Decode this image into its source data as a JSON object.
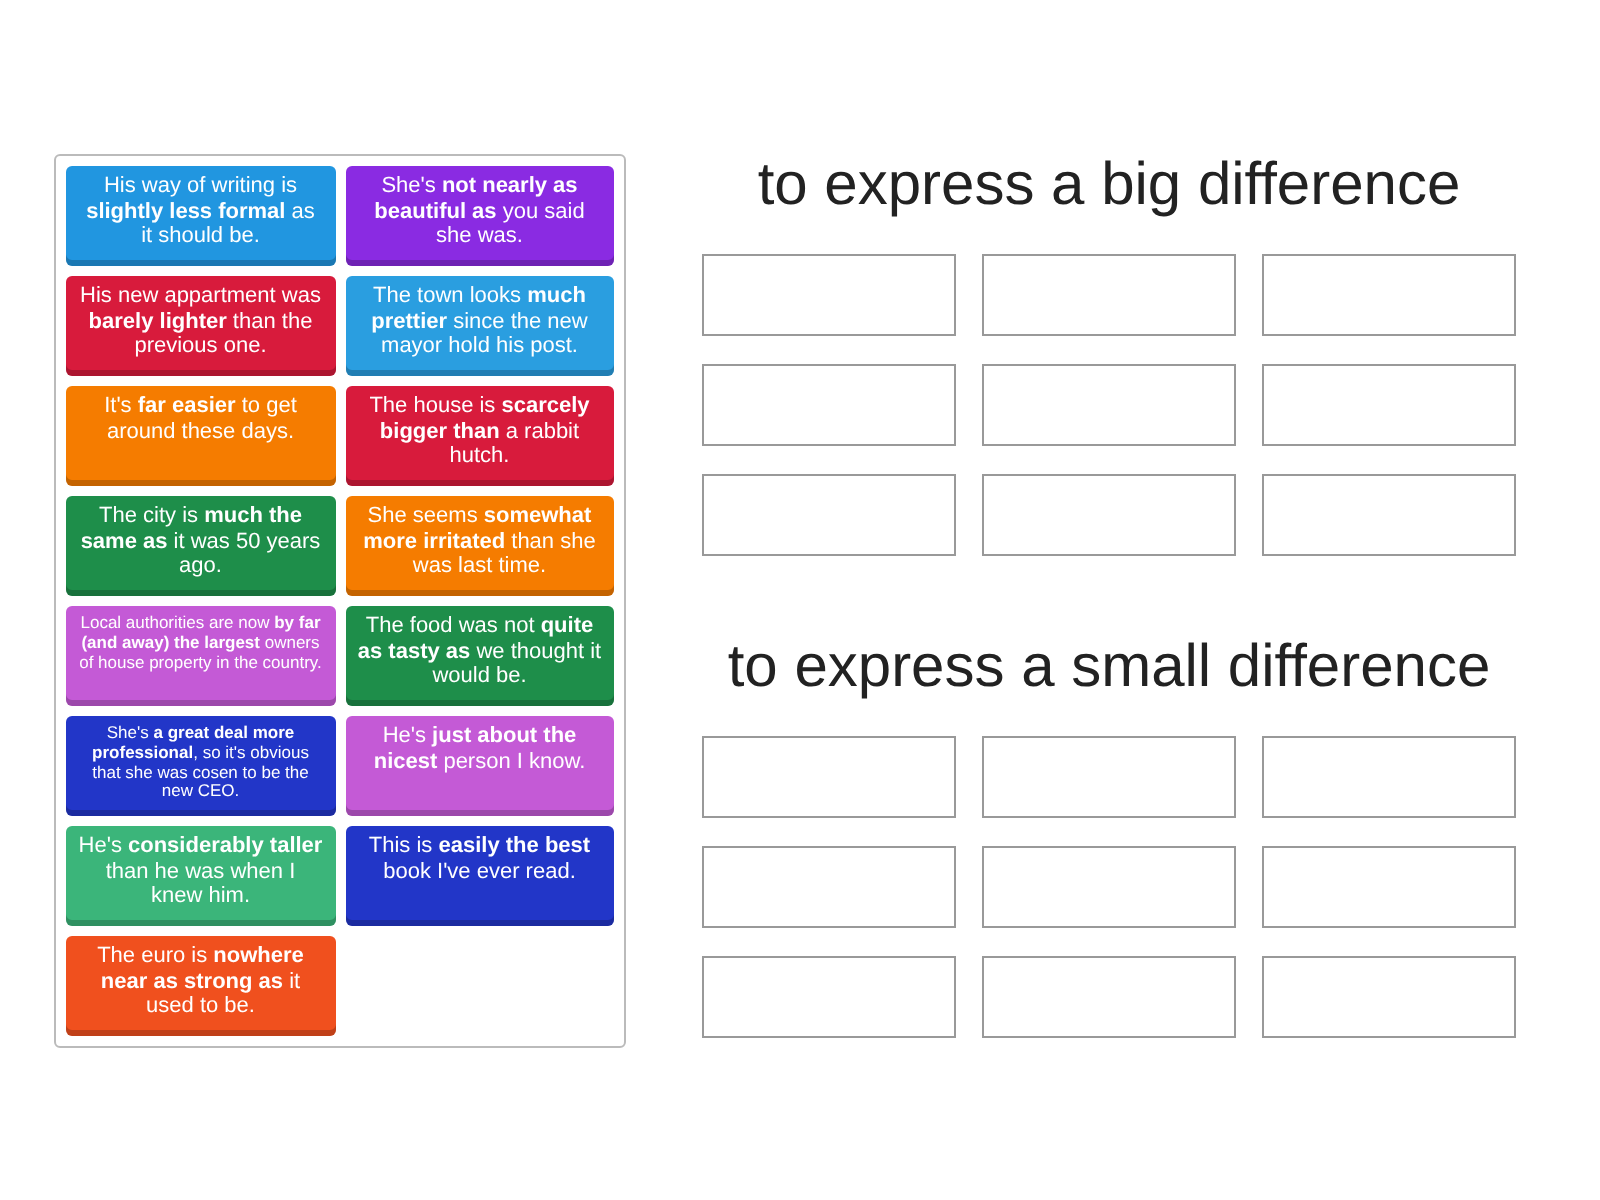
{
  "cards": [
    {
      "text": "His way of writing is **slightly less formal** as it should be.",
      "color": "#2196e0"
    },
    {
      "text": "She's **not nearly as beautiful as** you said she was.",
      "color": "#8a2be2"
    },
    {
      "text": "His new appartment was **barely lighter** than the previous one.",
      "color": "#d81b3c"
    },
    {
      "text": "The town looks **much prettier** since the new mayor hold his post.",
      "color": "#2a9ee0"
    },
    {
      "text": "It's **far easier** to get around these days.",
      "color": "#f57c00"
    },
    {
      "text": "The house is **scarcely bigger than** a rabbit hutch.",
      "color": "#d81b3c"
    },
    {
      "text": "The city is **much the same as** it was 50 years ago.",
      "color": "#1e8e4a"
    },
    {
      "text": "She seems **somewhat more irritated** than she was last time.",
      "color": "#f57c00"
    },
    {
      "text": "Local authorities are now **by far (and away) the largest** owners of house property in the country.",
      "color": "#c45ad6"
    },
    {
      "text": "The food was not **quite as tasty as** we thought it would be.",
      "color": "#1e8e4a"
    },
    {
      "text": "She's **a great deal more professional**, so it's obvious that she was cosen to be the new CEO.",
      "color": "#2236c8"
    },
    {
      "text": "He's **just about the nicest** person I know.",
      "color": "#c45ad6"
    },
    {
      "text": "He's **considerably taller** than he was when I knew him.",
      "color": "#3bb57a"
    },
    {
      "text": "This is **easily the best** book I've ever read.",
      "color": "#2236c8"
    },
    {
      "text": "The euro is **nowhere near as strong as** it used to be.",
      "color": "#f0501e"
    }
  ],
  "groups": [
    {
      "title": "to express a big difference"
    },
    {
      "title": "to express a small difference"
    }
  ]
}
